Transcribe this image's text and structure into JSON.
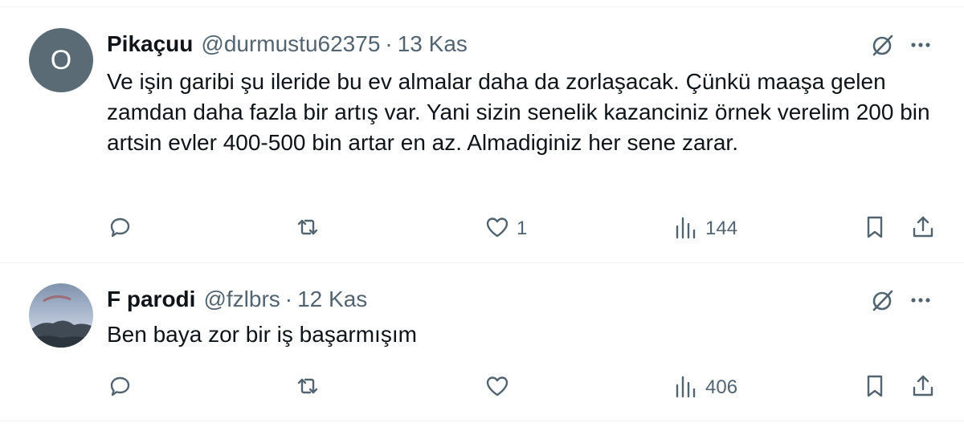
{
  "tweets": [
    {
      "avatar_letter": "O",
      "name": "Pikaçuu",
      "handle": "@durmustu62375",
      "separator": "·",
      "time": "13 Kas",
      "text": "Ve işin garibi şu ileride bu ev almalar daha da zorlaşacak. Çünkü maaşa gelen zamdan daha fazla bir artış var. Yani sizin senelik kazanciniz örnek verelim 200 bin artsin evler 400-500 bin artar en az. Almadiginiz her sene zarar.",
      "likes": "1",
      "views": "144"
    },
    {
      "avatar_letter": "",
      "name": "F parodi",
      "handle": "@fzlbrs",
      "separator": "·",
      "time": "12 Kas",
      "text": "Ben baya zor bir iş başarmışım",
      "likes": "",
      "views": "406"
    }
  ],
  "icons": {
    "grok": "grok-slash-icon",
    "more": "more-dots-icon",
    "reply": "reply-icon",
    "retweet": "retweet-icon",
    "like": "heart-icon",
    "views": "views-chart-icon",
    "bookmark": "bookmark-icon",
    "share": "share-icon"
  },
  "colors": {
    "text": "#0f1419",
    "secondary": "#536471",
    "divider": "#eff3f4",
    "avatar_bg": "#5b6b76"
  }
}
